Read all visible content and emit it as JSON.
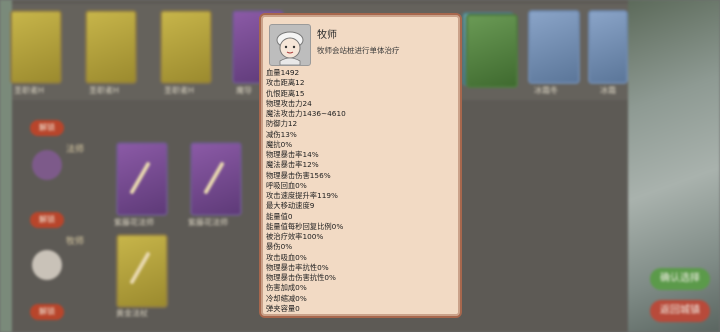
{
  "popup": {
    "title": "牧师",
    "description": "牧师会站桩进行单体治疗",
    "icon": "priest-chef-portrait-icon",
    "stats": [
      "血量1492",
      "攻击距离12",
      "仇恨距离15",
      "物理攻击力24",
      "魔法攻击力1436~4610",
      "防御力12",
      "减伤13%",
      "魔抗0%",
      "物理暴击率14%",
      "魔法暴击率12%",
      "物理暴击伤害156%",
      "呼吸回血0%",
      "攻击速度提升率119%",
      "最大移动速度9",
      "能量值0",
      "能量值每秒回复比例0%",
      "被治疗效率100%",
      "暴伤0%",
      "攻击吸血0%",
      "物理暴击率抗性0%",
      "物理暴击伤害抗性0%",
      "伤害加成0%",
      "冷却缩减0%",
      "弹夹容量0"
    ]
  },
  "background": {
    "top_cards": [
      {
        "label": "圣职者H",
        "style": "gold"
      },
      {
        "label": "圣职者H",
        "style": "gold"
      },
      {
        "label": "圣职者H",
        "style": "gold"
      },
      {
        "label": "魔导",
        "style": "purple"
      },
      {
        "label": "",
        "style": "purple"
      },
      {
        "label": "",
        "style": "teal"
      },
      {
        "label": "",
        "style": "teal"
      },
      {
        "label": "",
        "style": "green"
      },
      {
        "label": "冰霜冬",
        "style": "blue"
      },
      {
        "label": "冰霜",
        "style": "blue"
      }
    ],
    "side_buttons": [
      "解锁",
      "解锁",
      "解锁"
    ],
    "row_labels": [
      "法师",
      "牧师"
    ],
    "mid_cards": [
      {
        "label": "紫藤花法师",
        "style": "purple"
      },
      {
        "label": "紫藤花法师",
        "style": "purple"
      },
      {
        "label": "魔光杖",
        "style": "purple"
      }
    ],
    "low_cards": [
      {
        "label": "黄金法杖",
        "style": "gold"
      }
    ],
    "action_buttons": [
      {
        "label": "确认选择",
        "color": "#5b9a4a"
      },
      {
        "label": "返回城镇",
        "color": "#b84a3a"
      }
    ]
  }
}
